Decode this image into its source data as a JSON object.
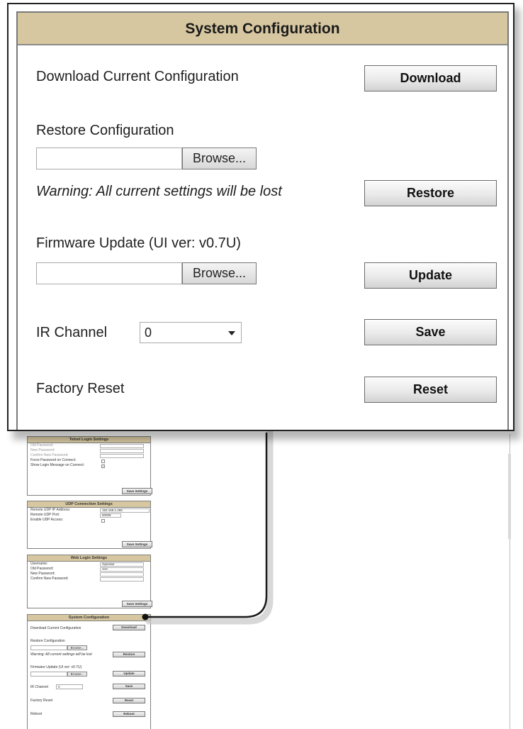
{
  "zoom": {
    "title": "System Configuration",
    "download_label": "Download Current Configuration",
    "download_button": "Download",
    "restore_label": "Restore Configuration",
    "browse_button": "Browse...",
    "warning": "Warning: All current settings will be lost",
    "restore_button": "Restore",
    "firmware_label": "Firmware Update (UI ver: v0.7U)",
    "update_button": "Update",
    "ir_label": "IR Channel",
    "ir_value": "0",
    "save_button": "Save",
    "factory_label": "Factory Reset",
    "reset_button": "Reset"
  },
  "telnet": {
    "title": "Telnet Login Settings",
    "old_password": "Old Password:",
    "new_password": "New Password:",
    "confirm_password": "Confirm New Password:",
    "force_password": "Force Password on Connect:",
    "show_login": "Show Login Message on Connect:",
    "show_login_checked": "✓",
    "save": "Save Settings"
  },
  "udp": {
    "title": "UDP Connection Settings",
    "ip_label": "Remote UDP IP Address:",
    "ip_value": "192.168.1.255",
    "port_label": "Remote UDP Port:",
    "port_value": "50008",
    "enable_label": "Enable UDP Access:",
    "save": "Save Settings"
  },
  "web": {
    "title": "Web Login Settings",
    "username_label": "Username:",
    "username_value": "Operator",
    "old_password": "Old Password:",
    "old_password_value": "•••••",
    "new_password": "New Password:",
    "confirm_password": "Confirm New Password:",
    "save": "Save Settings"
  },
  "mini_sys": {
    "title": "System Configuration",
    "download_label": "Download Current Configuration",
    "download_button": "Download",
    "restore_label": "Restore Configuration",
    "browse": "Browse...",
    "warning": "Warning: All current settings will be lost",
    "restore_button": "Restore",
    "firmware_label": "Firmware Update (UI ver: v0.7U)",
    "update_button": "Update",
    "ir_label": "IR Channel",
    "ir_value": "0",
    "save_button": "Save",
    "factory_label": "Factory Reset",
    "reset_button": "Reset",
    "reboot_label": "Reboot",
    "reboot_button": "Reboot"
  }
}
